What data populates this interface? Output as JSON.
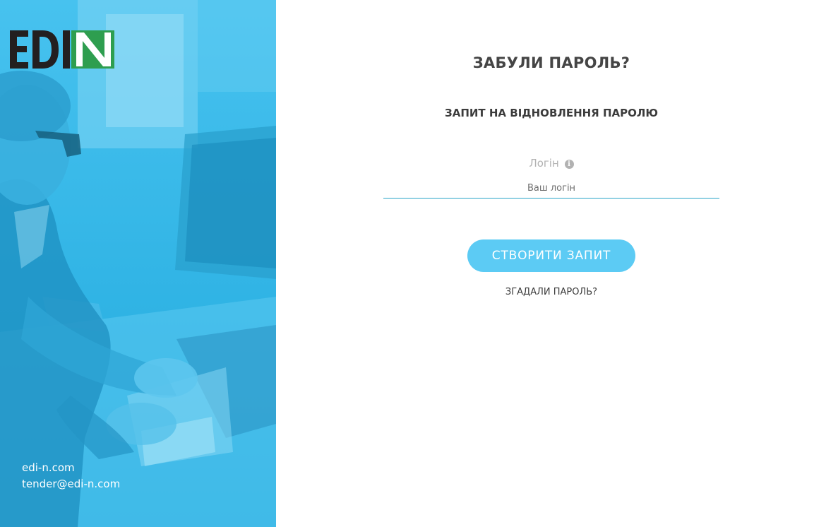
{
  "brand": {
    "logo_text": "EDIN",
    "colors": {
      "panel_blue": "#29b6e8",
      "logo_dark": "#231f20",
      "logo_green": "#2e9e4f",
      "button": "#5ccbf4",
      "input_underline": "#2aa6c9"
    }
  },
  "contact": {
    "website": "edi-n.com",
    "email": "tender@edi-n.com"
  },
  "form": {
    "title": "ЗАБУЛИ ПАРОЛЬ?",
    "subtitle": "ЗАПИТ НА ВІДНОВЛЕННЯ ПАРОЛЮ",
    "login": {
      "label": "Логін",
      "info_icon": "info-icon",
      "placeholder": "Ваш логін",
      "value": ""
    },
    "submit_label": "СТВОРИТИ ЗАПИТ",
    "remember_link": "ЗГАДАЛИ ПАРОЛЬ?"
  }
}
